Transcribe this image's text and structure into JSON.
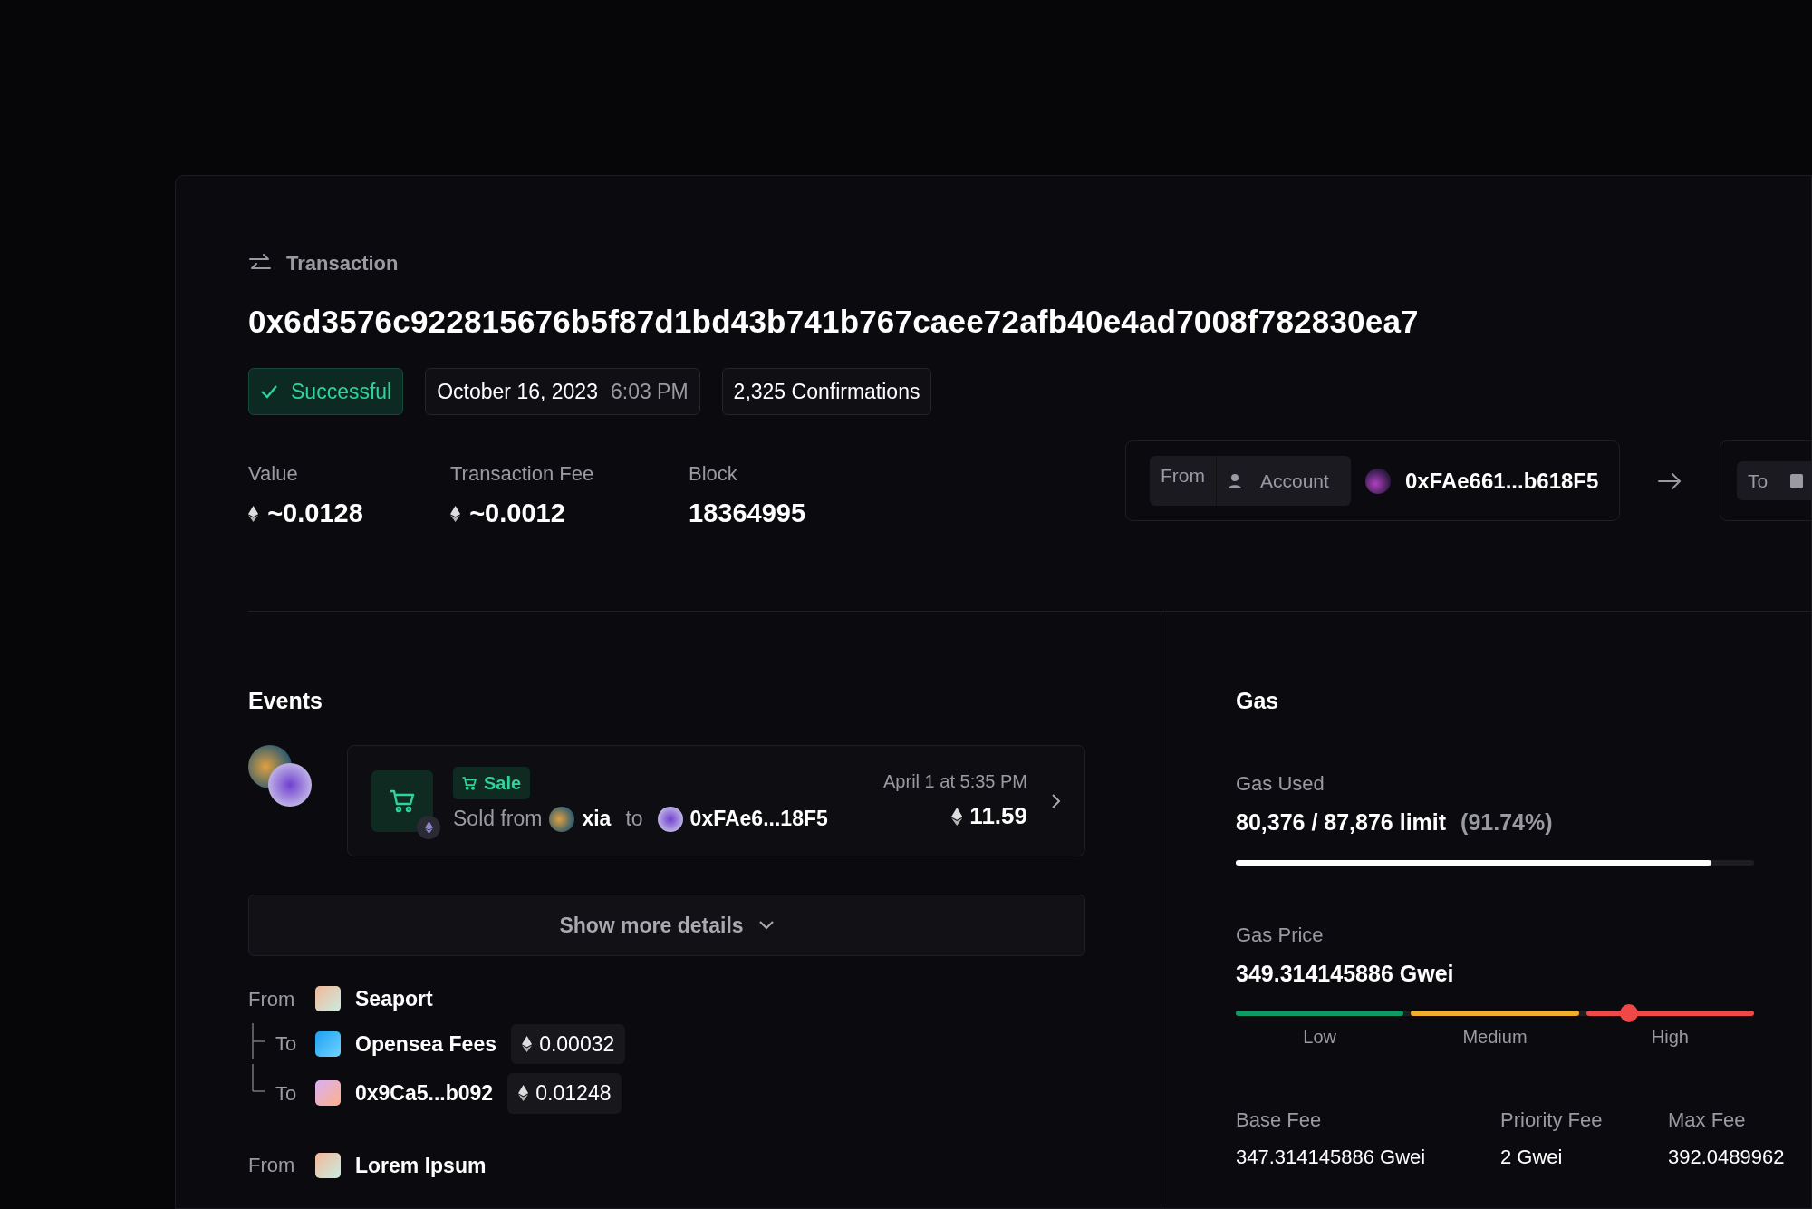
{
  "header": {
    "label": "Transaction",
    "hash": "0x6d3576c922815676b5f87d1bd43b741b767caee72afb40e4ad7008f782830ea7",
    "status": "Successful",
    "success": true,
    "date": "October 16, 2023",
    "time": "6:03 PM",
    "confirmations": "2,325 Confirmations"
  },
  "summary": [
    {
      "label": "Value",
      "value": "~0.0128",
      "kind": "eth"
    },
    {
      "label": "Transaction Fee",
      "value": "~0.0012",
      "kind": "eth"
    },
    {
      "label": "Block",
      "value": "18364995",
      "kind": "plain"
    }
  ],
  "from": {
    "tag": "From",
    "type": "Account",
    "address": "0xFAe661...b618F5"
  },
  "to": {
    "tag": "To"
  },
  "events": {
    "title": "Events",
    "items": [
      {
        "badge": "Sale",
        "time": "April 1 at 5:35 PM",
        "sold_from": "Sold from",
        "seller": "xia",
        "to_word": "to",
        "buyer": "0xFAe6...18F5",
        "amount": "11.59"
      }
    ],
    "more": "Show more details"
  },
  "transfers": [
    {
      "label": "From",
      "name": "Seaport",
      "children": [
        {
          "label": "To",
          "name": "Opensea Fees",
          "amount": "0.00032"
        },
        {
          "label": "To",
          "name": "0x9Ca5...b092",
          "amount": "0.01248"
        }
      ]
    },
    {
      "label": "From",
      "name": "Lorem Ipsum"
    }
  ],
  "gas": {
    "title": "Gas",
    "used_label": "Gas Used",
    "used": "80,376 / 87,876 limit",
    "used_pct": "(91.74%)",
    "level": 0.9174,
    "price_label": "Gas Price",
    "price": "349.314145886 Gwei",
    "price_meter": {
      "level": 0.758
    },
    "scale": [
      {
        "label": "Low",
        "color": "#0e9a62"
      },
      {
        "label": "Medium",
        "color": "#f0ae2b"
      },
      {
        "label": "High",
        "color": "#ee4848"
      }
    ],
    "fees": [
      {
        "label": "Base Fee",
        "value": "347.314145886 Gwei"
      },
      {
        "label": "Priority Fee",
        "value": "2 Gwei"
      },
      {
        "label": "Max Fee",
        "value": "392.0489962"
      }
    ]
  }
}
